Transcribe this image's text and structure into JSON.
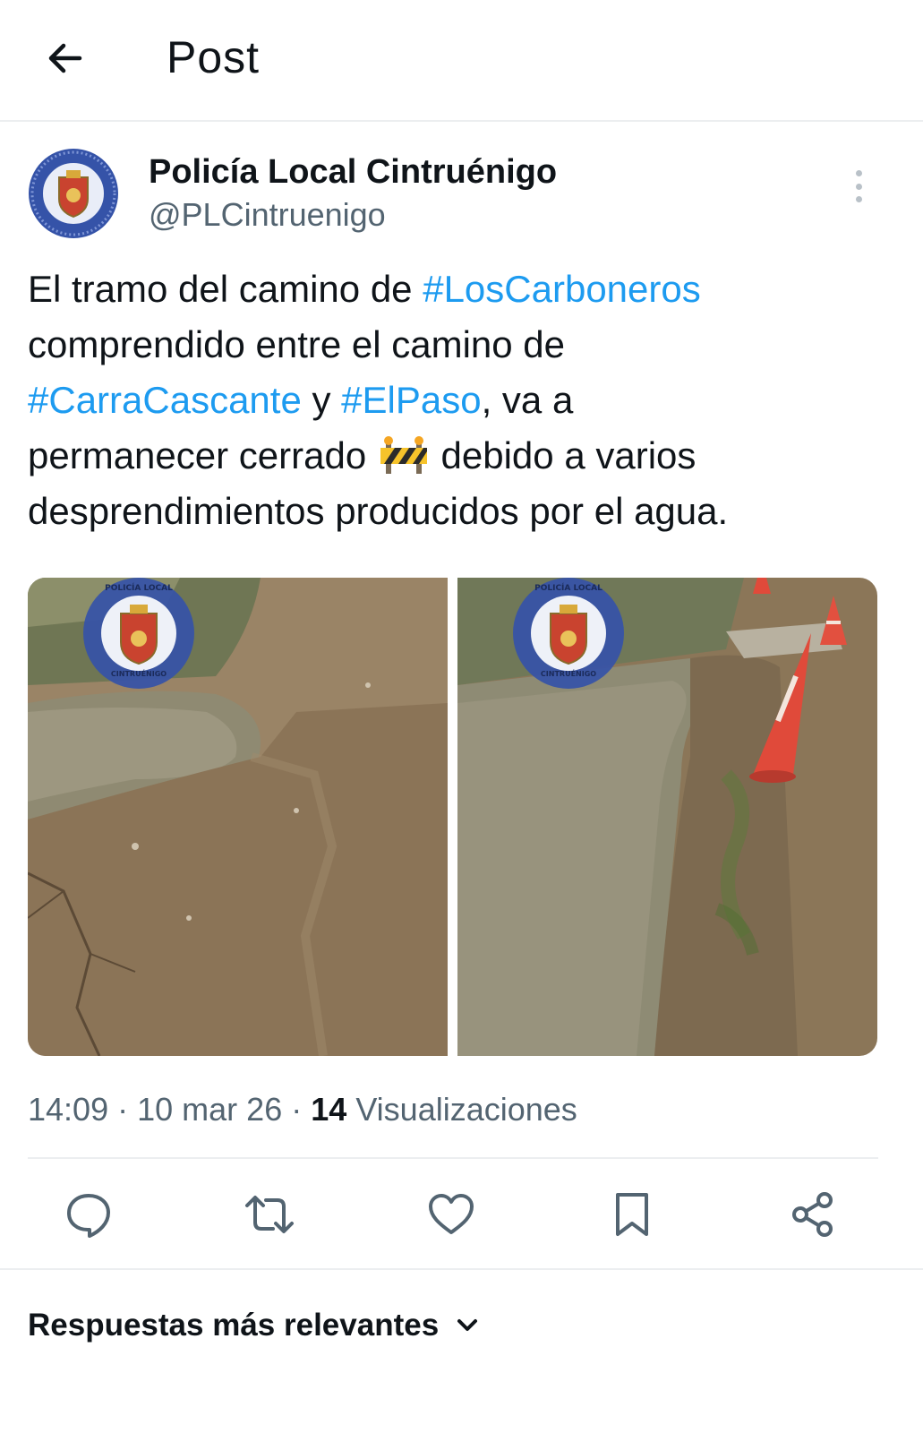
{
  "header": {
    "title": "Post"
  },
  "author": {
    "name": "Policía Local Cintruénigo",
    "handle": "@PLCintruenigo"
  },
  "tweet": {
    "lines": [
      [
        {
          "t": "El tramo del camino de ",
          "h": false
        },
        {
          "t": "#LosCarboneros",
          "h": true
        }
      ],
      [
        {
          "t": "comprendido entre el camino de",
          "h": false
        }
      ],
      [
        {
          "t": "#CarraCascante",
          "h": true
        },
        {
          "t": " y ",
          "h": false
        },
        {
          "t": "#ElPaso",
          "h": true
        },
        {
          "t": ", va a",
          "h": false
        }
      ],
      [
        {
          "t": "permanecer cerrado ",
          "h": false
        },
        {
          "t": "[construction-emoji]",
          "h": false,
          "emoji": true
        },
        {
          "t": " debido a varios",
          "h": false
        }
      ],
      [
        {
          "t": "desprendimientos producidos por el agua.",
          "h": false
        }
      ]
    ]
  },
  "media": [
    {
      "watermark_top": "POLICÍA LOCAL",
      "watermark_bottom": "CINTRUÉNIGO"
    },
    {
      "watermark_top": "POLICÍA LOCAL",
      "watermark_bottom": "CINTRUÉNIGO"
    }
  ],
  "meta": {
    "time": "14:09",
    "date": "10 mar 26",
    "views_count": "14",
    "views_label": "Visualizaciones",
    "separator": "·"
  },
  "actions": [
    "reply-icon",
    "retweet-icon",
    "like-icon",
    "bookmark-icon",
    "share-icon"
  ],
  "replies": {
    "label": "Respuestas más relevantes"
  },
  "colors": {
    "link": "#1d9bf0",
    "secondary_text": "#536471",
    "primary_text": "#0f1419",
    "divider": "#eceef0",
    "badge_blue": "#3553a8"
  }
}
